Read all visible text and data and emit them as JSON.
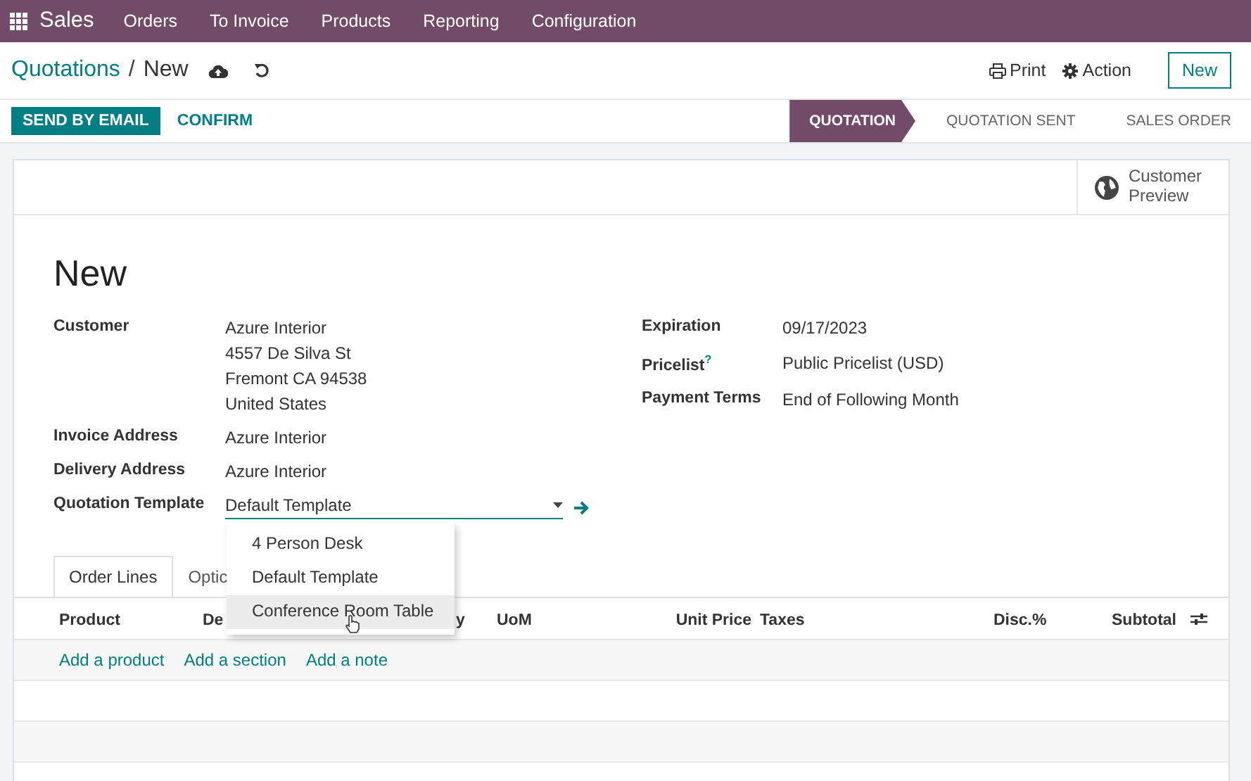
{
  "navbar": {
    "app": "Sales",
    "menu": [
      "Orders",
      "To Invoice",
      "Products",
      "Reporting",
      "Configuration"
    ]
  },
  "control_panel": {
    "breadcrumb_parent": "Quotations",
    "breadcrumb_separator": "/",
    "breadcrumb_current": "New",
    "print": "Print",
    "action": "Action",
    "new_button": "New"
  },
  "actions": [
    {
      "label": "SEND BY EMAIL",
      "primary": true
    },
    {
      "label": "CONFIRM",
      "primary": false
    }
  ],
  "status_steps": [
    {
      "label": "QUOTATION",
      "selected": true
    },
    {
      "label": "QUOTATION SENT",
      "selected": false
    },
    {
      "label": "SALES ORDER",
      "selected": false
    }
  ],
  "customer_preview": "Customer\nPreview",
  "title": "New",
  "left_fields": [
    {
      "label": "Customer",
      "value": [
        "Azure Interior",
        "4557 De Silva St",
        "Fremont CA 94538",
        "United States"
      ]
    },
    {
      "label": "Invoice Address",
      "value": [
        "Azure Interior"
      ]
    },
    {
      "label": "Delivery Address",
      "value": [
        "Azure Interior"
      ]
    }
  ],
  "template_field": {
    "label": "Quotation Template",
    "value": "Default Template"
  },
  "right_fields": [
    {
      "label": "Expiration",
      "value": "09/17/2023"
    },
    {
      "label": "Pricelist",
      "value": "Public Pricelist (USD)",
      "help": "?"
    },
    {
      "label": "Payment Terms",
      "value": "End of Following Month"
    }
  ],
  "dropdown": [
    {
      "label": "4 Person Desk",
      "selected": false
    },
    {
      "label": "Default Template",
      "selected": false
    },
    {
      "label": "Conference Room Table",
      "selected": true
    }
  ],
  "tabs": [
    {
      "label": "Order Lines",
      "selected": true
    },
    {
      "label": "Optic",
      "selected": false
    }
  ],
  "table": {
    "columns": [
      "Product",
      "De",
      "y",
      "UoM",
      "Unit Price",
      "Taxes",
      "Disc.%",
      "Subtotal"
    ],
    "add_links": [
      "Add a product",
      "Add a section",
      "Add a note"
    ]
  }
}
